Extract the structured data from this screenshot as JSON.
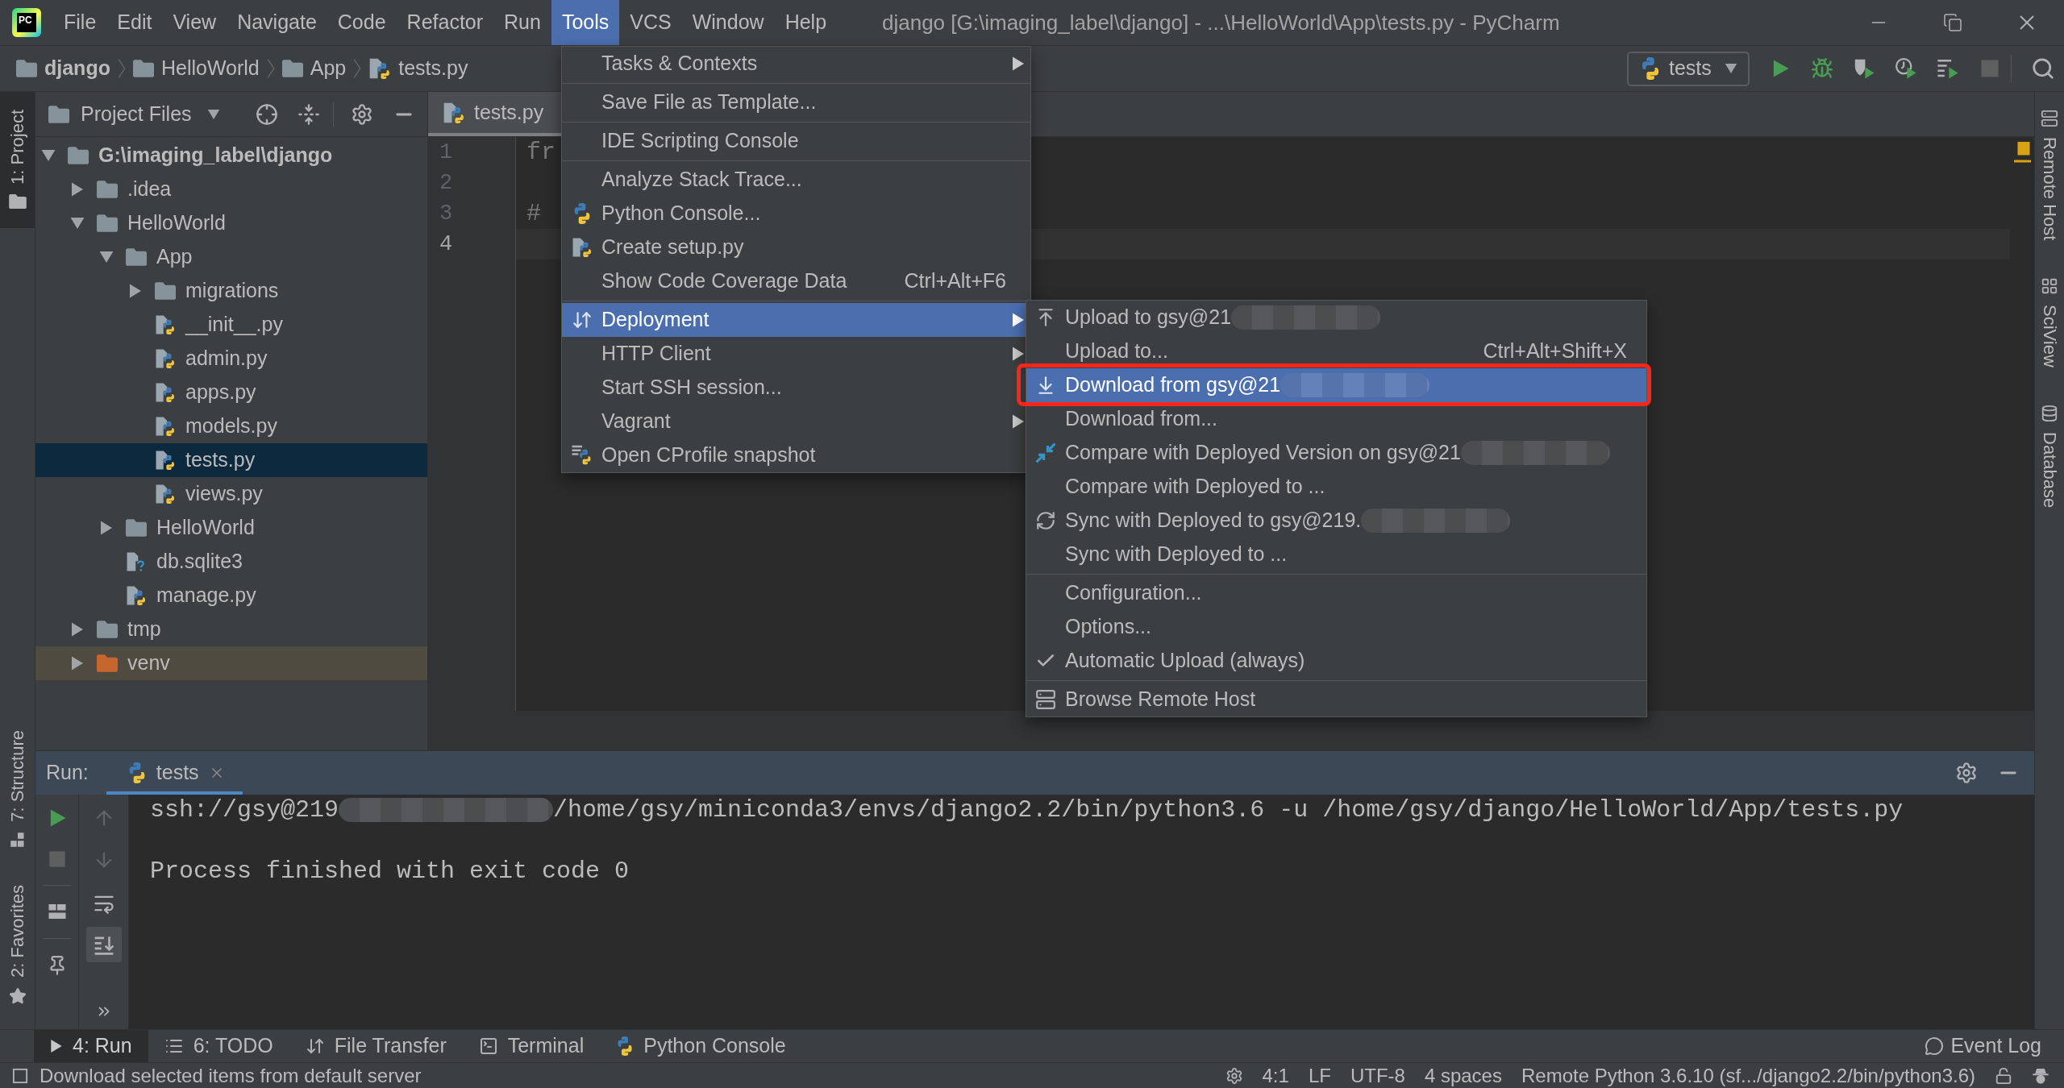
{
  "title_bar": {
    "logo": "PC",
    "menus": [
      {
        "label": "File",
        "selected": false
      },
      {
        "label": "Edit",
        "selected": false
      },
      {
        "label": "View",
        "selected": false
      },
      {
        "label": "Navigate",
        "selected": false
      },
      {
        "label": "Code",
        "selected": false
      },
      {
        "label": "Refactor",
        "selected": false
      },
      {
        "label": "Run",
        "selected": false
      },
      {
        "label": "Tools",
        "selected": true
      },
      {
        "label": "VCS",
        "selected": false
      },
      {
        "label": "Window",
        "selected": false
      },
      {
        "label": "Help",
        "selected": false
      }
    ],
    "title": "django [G:\\imaging_label\\django] - ...\\HelloWorld\\App\\tests.py - PyCharm"
  },
  "nav_bar": {
    "breadcrumbs": [
      {
        "label": "django",
        "kind": "project"
      },
      {
        "label": "HelloWorld",
        "kind": "folder"
      },
      {
        "label": "App",
        "kind": "folder"
      },
      {
        "label": "tests.py",
        "kind": "python_file"
      }
    ],
    "run_config": "tests"
  },
  "left_stripe": [
    {
      "label": "1: Project",
      "selected": true
    },
    {
      "label": "7: Structure",
      "selected": false
    },
    {
      "label": "2: Favorites",
      "selected": false
    }
  ],
  "project_panel": {
    "title": "Project Files",
    "tree": [
      {
        "name": "G:\\imaging_label\\django",
        "kind": "folder",
        "expanded": true,
        "selected": false,
        "excluded": false,
        "children": [
          {
            "name": ".idea",
            "kind": "folder",
            "expanded": false,
            "selected": false,
            "excluded": false
          },
          {
            "name": "HelloWorld",
            "kind": "folder",
            "expanded": true,
            "selected": false,
            "excluded": false,
            "children": [
              {
                "name": "App",
                "kind": "folder",
                "expanded": true,
                "selected": false,
                "excluded": false,
                "children": [
                  {
                    "name": "migrations",
                    "kind": "folder",
                    "expanded": false,
                    "selected": false,
                    "excluded": false
                  },
                  {
                    "name": "__init__.py",
                    "kind": "python_file",
                    "selected": false,
                    "excluded": false
                  },
                  {
                    "name": "admin.py",
                    "kind": "python_file",
                    "selected": false,
                    "excluded": false
                  },
                  {
                    "name": "apps.py",
                    "kind": "python_file",
                    "selected": false,
                    "excluded": false
                  },
                  {
                    "name": "models.py",
                    "kind": "python_file",
                    "selected": false,
                    "excluded": false
                  },
                  {
                    "name": "tests.py",
                    "kind": "python_file",
                    "selected": true,
                    "excluded": false
                  },
                  {
                    "name": "views.py",
                    "kind": "python_file",
                    "selected": false,
                    "excluded": false
                  }
                ]
              },
              {
                "name": "HelloWorld",
                "kind": "folder",
                "expanded": false,
                "selected": false,
                "excluded": false
              },
              {
                "name": "db.sqlite3",
                "kind": "unknown_file",
                "selected": false,
                "excluded": false
              },
              {
                "name": "manage.py",
                "kind": "python_file",
                "selected": false,
                "excluded": false
              }
            ]
          },
          {
            "name": "tmp",
            "kind": "folder",
            "expanded": false,
            "selected": false,
            "excluded": false
          },
          {
            "name": "venv",
            "kind": "folder",
            "expanded": false,
            "selected": false,
            "excluded": true
          }
        ]
      }
    ]
  },
  "editor": {
    "tabs": [
      {
        "label": "tests.py",
        "selected": true
      }
    ],
    "lines": [
      {
        "number": "1",
        "code": "fr",
        "current": false
      },
      {
        "number": "2",
        "current": false
      },
      {
        "number": "3",
        "code": "#",
        "current": false
      },
      {
        "number": "4",
        "current": true
      }
    ]
  },
  "tools_menu": {
    "items": [
      {
        "kind": "item",
        "label": "Tasks & Contexts",
        "submenu": true,
        "selected": false
      },
      {
        "kind": "separator"
      },
      {
        "kind": "item",
        "label": "Save File as Template...",
        "submenu": false,
        "selected": false
      },
      {
        "kind": "separator"
      },
      {
        "kind": "item",
        "label": "IDE Scripting Console",
        "submenu": false,
        "selected": false
      },
      {
        "kind": "separator"
      },
      {
        "kind": "item",
        "label": "Analyze Stack Trace...",
        "submenu": false,
        "selected": false
      },
      {
        "kind": "item",
        "label": "Python Console...",
        "submenu": false,
        "selected": false
      },
      {
        "kind": "item",
        "label": "Create setup.py",
        "submenu": false,
        "selected": false
      },
      {
        "kind": "item",
        "label": "Show Code Coverage Data",
        "shortcut": "Ctrl+Alt+F6",
        "submenu": false,
        "selected": false
      },
      {
        "kind": "separator"
      },
      {
        "kind": "item",
        "label": "Deployment",
        "submenu": true,
        "selected": true
      },
      {
        "kind": "item",
        "label": "HTTP Client",
        "submenu": true,
        "selected": false
      },
      {
        "kind": "item",
        "label": "Start SSH session...",
        "submenu": false,
        "selected": false
      },
      {
        "kind": "item",
        "label": "Vagrant",
        "submenu": true,
        "selected": false
      },
      {
        "kind": "item",
        "label": "Open CProfile snapshot",
        "submenu": false,
        "selected": false
      }
    ]
  },
  "deployment_menu": {
    "items": [
      {
        "kind": "item",
        "label": "Upload to gsy@21",
        "redacted": true,
        "selected": false,
        "outlined": false,
        "checked": false
      },
      {
        "kind": "item",
        "label": "Upload to...",
        "shortcut": "Ctrl+Alt+Shift+X",
        "redacted": false,
        "selected": false,
        "outlined": false,
        "checked": false
      },
      {
        "kind": "item",
        "label": "Download from gsy@21",
        "redacted": true,
        "selected": true,
        "outlined": true,
        "checked": false
      },
      {
        "kind": "item",
        "label": "Download from...",
        "redacted": false,
        "selected": false,
        "outlined": false,
        "checked": false
      },
      {
        "kind": "item",
        "label": "Compare with Deployed Version on gsy@21",
        "redacted": true,
        "selected": false,
        "outlined": false,
        "checked": false
      },
      {
        "kind": "item",
        "label": "Compare with Deployed to ...",
        "redacted": false,
        "selected": false,
        "outlined": false,
        "checked": false
      },
      {
        "kind": "item",
        "label": "Sync with Deployed to gsy@219.",
        "redacted": true,
        "selected": false,
        "outlined": false,
        "checked": false
      },
      {
        "kind": "item",
        "label": "Sync with Deployed to ...",
        "redacted": false,
        "selected": false,
        "outlined": false,
        "checked": false
      },
      {
        "kind": "separator"
      },
      {
        "kind": "item",
        "label": "Configuration...",
        "redacted": false,
        "selected": false,
        "outlined": false,
        "checked": false
      },
      {
        "kind": "item",
        "label": "Options...",
        "redacted": false,
        "selected": false,
        "outlined": false,
        "checked": false
      },
      {
        "kind": "item",
        "label": "Automatic Upload (always)",
        "redacted": false,
        "selected": false,
        "outlined": false,
        "checked": true
      },
      {
        "kind": "separator"
      },
      {
        "kind": "item",
        "label": "Browse Remote Host",
        "redacted": false,
        "selected": false,
        "outlined": false,
        "checked": false
      }
    ]
  },
  "run_panel": {
    "title": "Run:",
    "tabs": [
      {
        "label": "tests",
        "selected": true
      }
    ],
    "scroll_to_end": true,
    "console": [
      {
        "kind": "command",
        "parts": [
          {
            "kind": "text",
            "text": "ssh://gsy@219"
          },
          {
            "kind": "redacted"
          },
          {
            "kind": "text",
            "text": "/home/gsy/miniconda3/envs/django2.2/bin/python3.6 -u /home/gsy/django/HelloWorld/App/tests.py"
          }
        ]
      },
      {
        "kind": "status",
        "parts": [
          {
            "kind": "text",
            "text": "Process finished with exit code 0"
          }
        ]
      }
    ]
  },
  "right_stripe": [
    {
      "label": "Remote Host",
      "selected": false
    },
    {
      "label": "SciView",
      "selected": false
    },
    {
      "label": "Database",
      "selected": false
    }
  ],
  "tool_tabs_bar": {
    "tabs": [
      {
        "label": "4: Run",
        "selected": true
      },
      {
        "label": "6: TODO",
        "selected": false
      },
      {
        "label": "File Transfer",
        "selected": false
      },
      {
        "label": "Terminal",
        "selected": false
      },
      {
        "label": "Python Console",
        "selected": false
      }
    ],
    "event_log": "Event Log"
  },
  "status_bar": {
    "message": "Download selected items from default server",
    "items": [
      "4:1",
      "LF",
      "UTF-8",
      "4 spaces",
      "Remote Python 3.6.10 (sf.../django2.2/bin/python3.6)"
    ]
  }
}
